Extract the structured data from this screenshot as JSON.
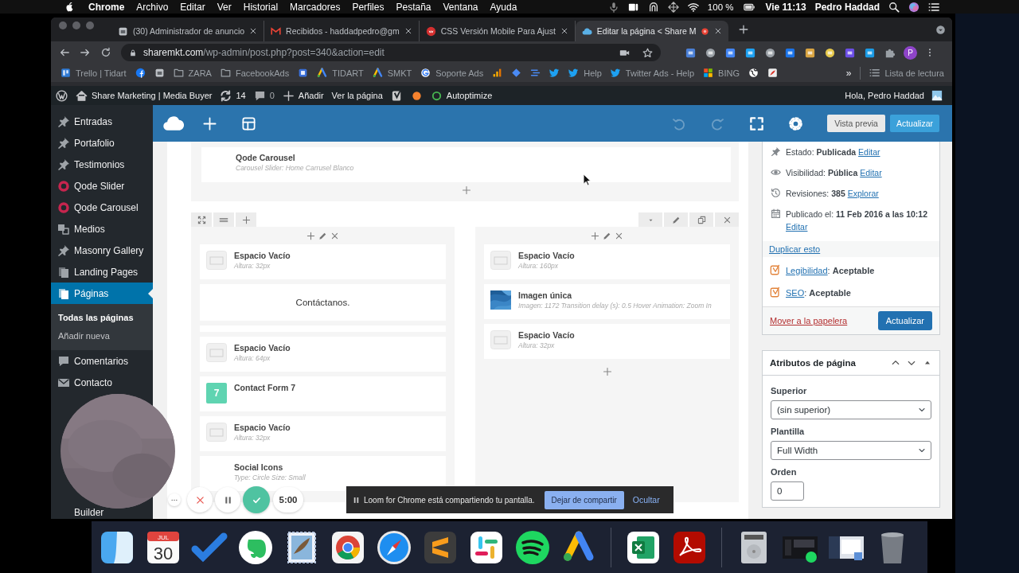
{
  "menu_bar": {
    "app": "Chrome",
    "menus": [
      "Archivo",
      "Editar",
      "Ver",
      "Historial",
      "Marcadores",
      "Perfiles",
      "Pestaña",
      "Ventana",
      "Ayuda"
    ],
    "battery": "100 %",
    "clock": "Vie 11:13",
    "user": "Pedro Haddad"
  },
  "browser": {
    "tabs": [
      {
        "title": "(30) Administrador de anuncio",
        "selected": false,
        "recording": false
      },
      {
        "title": "Recibidos - haddadpedro@gm",
        "selected": false,
        "recording": false
      },
      {
        "title": "CSS Versión Mobile Para Ajust",
        "selected": false,
        "recording": false
      },
      {
        "title": "Editar la página < Share M",
        "selected": true,
        "recording": true
      }
    ],
    "url_host": "sharemkt.com",
    "url_path": "/wp-admin/post.php?post=340&action=edit",
    "profile": "P",
    "bookmarks": [
      {
        "kind": "link",
        "label": "Trello | Tidart"
      },
      {
        "kind": "icon"
      },
      {
        "kind": "icon"
      },
      {
        "kind": "link",
        "label": "ZARA"
      },
      {
        "kind": "link",
        "label": "FacebookAds"
      },
      {
        "kind": "icon"
      },
      {
        "kind": "link",
        "label": "TIDART"
      },
      {
        "kind": "link",
        "label": "SMKT"
      },
      {
        "kind": "link",
        "label": "Soporte Ads"
      },
      {
        "kind": "icon"
      },
      {
        "kind": "icon"
      },
      {
        "kind": "icon"
      },
      {
        "kind": "icon"
      },
      {
        "kind": "link",
        "label": "Help"
      },
      {
        "kind": "link",
        "label": "Twitter Ads - Help"
      },
      {
        "kind": "link",
        "label": "BING"
      },
      {
        "kind": "icon"
      },
      {
        "kind": "icon"
      }
    ],
    "bookmarks_more": "»",
    "reading_list": "Lista de lectura"
  },
  "admin_bar": {
    "site": "Share Marketing | Media Buyer",
    "updates": "14",
    "comments": "0",
    "new": "Añadir",
    "view": "Ver la página",
    "autoptimize": "Autoptimize",
    "greeting": "Hola, Pedro Haddad"
  },
  "sidebar": {
    "items": [
      {
        "label": "Entradas",
        "selected": false
      },
      {
        "label": "Portafolio",
        "selected": false
      },
      {
        "label": "Testimonios",
        "selected": false
      },
      {
        "label": "Qode Slider",
        "selected": false
      },
      {
        "label": "Qode Carousel",
        "selected": false
      },
      {
        "label": "Medios",
        "selected": false
      },
      {
        "label": "Masonry Gallery",
        "selected": false
      },
      {
        "label": "Landing Pages",
        "selected": false
      },
      {
        "label": "Páginas",
        "selected": true,
        "submenu": [
          {
            "label": "Todas las páginas",
            "selected": true
          },
          {
            "label": "Añadir nueva",
            "selected": false
          }
        ]
      },
      {
        "label": "Comentarios",
        "selected": false
      },
      {
        "label": "Contacto",
        "selected": false
      },
      {
        "label": "Builder",
        "selected": false
      }
    ]
  },
  "builder": {
    "toolbar": {
      "undo": {
        "disabled": true
      },
      "redo": {
        "disabled": true
      },
      "preview": "Vista previa",
      "update": "Actualizar"
    },
    "top_row": [
      {
        "kind": "plain",
        "title": "Qode Carousel",
        "detail": "Carousel Slider: Home Carrusel Blanco"
      }
    ],
    "columns": [
      [
        {
          "kind": "spacer",
          "title": "Espacio Vacío",
          "detail": "Altura: 32px"
        },
        {
          "kind": "text",
          "text": "Contáctanos."
        },
        {
          "kind": "empty"
        },
        {
          "kind": "spacer",
          "title": "Espacio Vacío",
          "detail": "Altura: 64px"
        },
        {
          "kind": "form",
          "badge": "7",
          "title": "Contact Form 7"
        },
        {
          "kind": "spacer",
          "title": "Espacio Vacío",
          "detail": "Altura: 32px"
        },
        {
          "kind": "plain",
          "title": "Social Icons",
          "detail": "Type: Circle Size: Small"
        }
      ],
      [
        {
          "kind": "spacer",
          "title": "Espacio Vacío",
          "detail": "Altura: 160px"
        },
        {
          "title": "Imagen única",
          "detail": "Imagen: 1172  Transition delay (s): 0.5  Hover Animation: Zoom In"
        },
        {
          "kind": "spacer",
          "title": "Espacio Vacío",
          "detail": "Altura: 32px"
        }
      ]
    ]
  },
  "publish": {
    "rows": [
      {
        "label": "Estado:",
        "value": "Publicada",
        "link": "Editar"
      },
      {
        "label": "Visibilidad:",
        "value": "Pública",
        "link": "Editar"
      },
      {
        "label": "Revisiones:",
        "value": "385",
        "link": "Explorar"
      },
      {
        "label": "Publicado el:",
        "value": "11 Feb 2016 a las 10:12",
        "link": "Editar"
      }
    ],
    "duplicate": "Duplicar esto",
    "seo": [
      {
        "link": "Legibilidad",
        "text": ": **Aceptable**"
      },
      {
        "link": "SEO",
        "text": ": **Aceptable**"
      }
    ],
    "trash": "Mover a la papelera",
    "update": "Actualizar"
  },
  "attributes": {
    "title": "Atributos de página",
    "parent_label": "Superior",
    "parent_value": "(sin superior)",
    "template_label": "Plantilla",
    "template_value": "Full Width",
    "order_label": "Orden",
    "order_value": "0"
  },
  "loom": {
    "timer": "5:00",
    "message": "Loom for Chrome está compartiendo tu pantalla.",
    "stop": "Dejar de compartir",
    "hide": "Ocultar"
  },
  "dock": {
    "calendar_month": "JUL",
    "calendar_day": "30"
  }
}
